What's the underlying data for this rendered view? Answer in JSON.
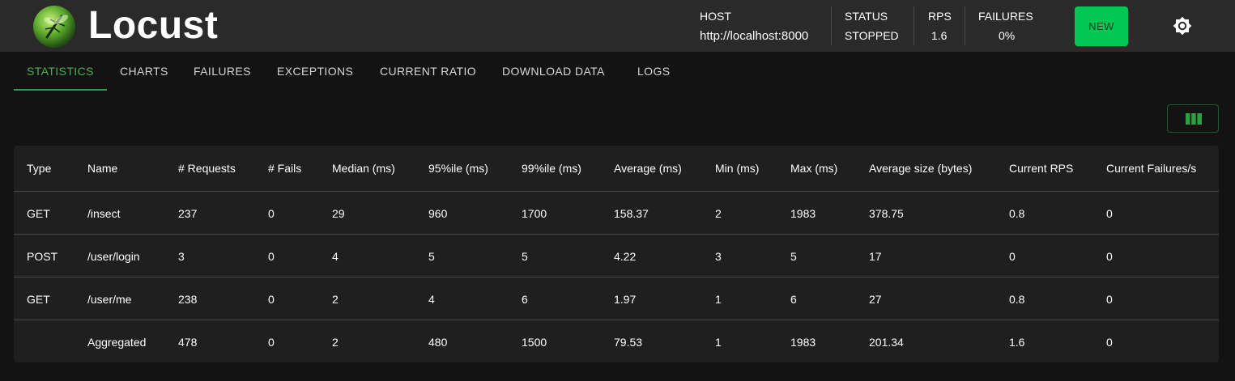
{
  "app": {
    "title": "Locust"
  },
  "header": {
    "host_label": "HOST",
    "host_value": "http://localhost:8000",
    "status_label": "STATUS",
    "status_value": "STOPPED",
    "rps_label": "RPS",
    "rps_value": "1.6",
    "failures_label": "FAILURES",
    "failures_value": "0%",
    "new_button": "NEW",
    "theme_icon": "brightness-icon"
  },
  "tabs": [
    {
      "label": "STATISTICS",
      "active": true
    },
    {
      "label": "CHARTS"
    },
    {
      "label": "FAILURES"
    },
    {
      "label": "EXCEPTIONS"
    },
    {
      "label": "CURRENT RATIO"
    },
    {
      "label": "DOWNLOAD DATA"
    },
    {
      "label": "LOGS"
    }
  ],
  "toolbar": {
    "columns_icon": "view-columns-icon"
  },
  "table": {
    "columns": [
      "Type",
      "Name",
      "# Requests",
      "# Fails",
      "Median (ms)",
      "95%ile (ms)",
      "99%ile (ms)",
      "Average (ms)",
      "Min (ms)",
      "Max (ms)",
      "Average size (bytes)",
      "Current RPS",
      "Current Failures/s"
    ],
    "rows": [
      [
        "GET",
        "/insect",
        "237",
        "0",
        "29",
        "960",
        "1700",
        "158.37",
        "2",
        "1983",
        "378.75",
        "0.8",
        "0"
      ],
      [
        "POST",
        "/user/login",
        "3",
        "0",
        "4",
        "5",
        "5",
        "4.22",
        "3",
        "5",
        "17",
        "0",
        "0"
      ],
      [
        "GET",
        "/user/me",
        "238",
        "0",
        "2",
        "4",
        "6",
        "1.97",
        "1",
        "6",
        "27",
        "0.8",
        "0"
      ],
      [
        "",
        "Aggregated",
        "478",
        "0",
        "2",
        "480",
        "1500",
        "79.53",
        "1",
        "1983",
        "201.34",
        "1.6",
        "0"
      ]
    ]
  },
  "colors": {
    "accent": "#4caf50",
    "new_button": "#00c853",
    "header_bg": "#2a2a2a",
    "page_bg": "#131313",
    "table_bg": "#1f1f1f"
  }
}
